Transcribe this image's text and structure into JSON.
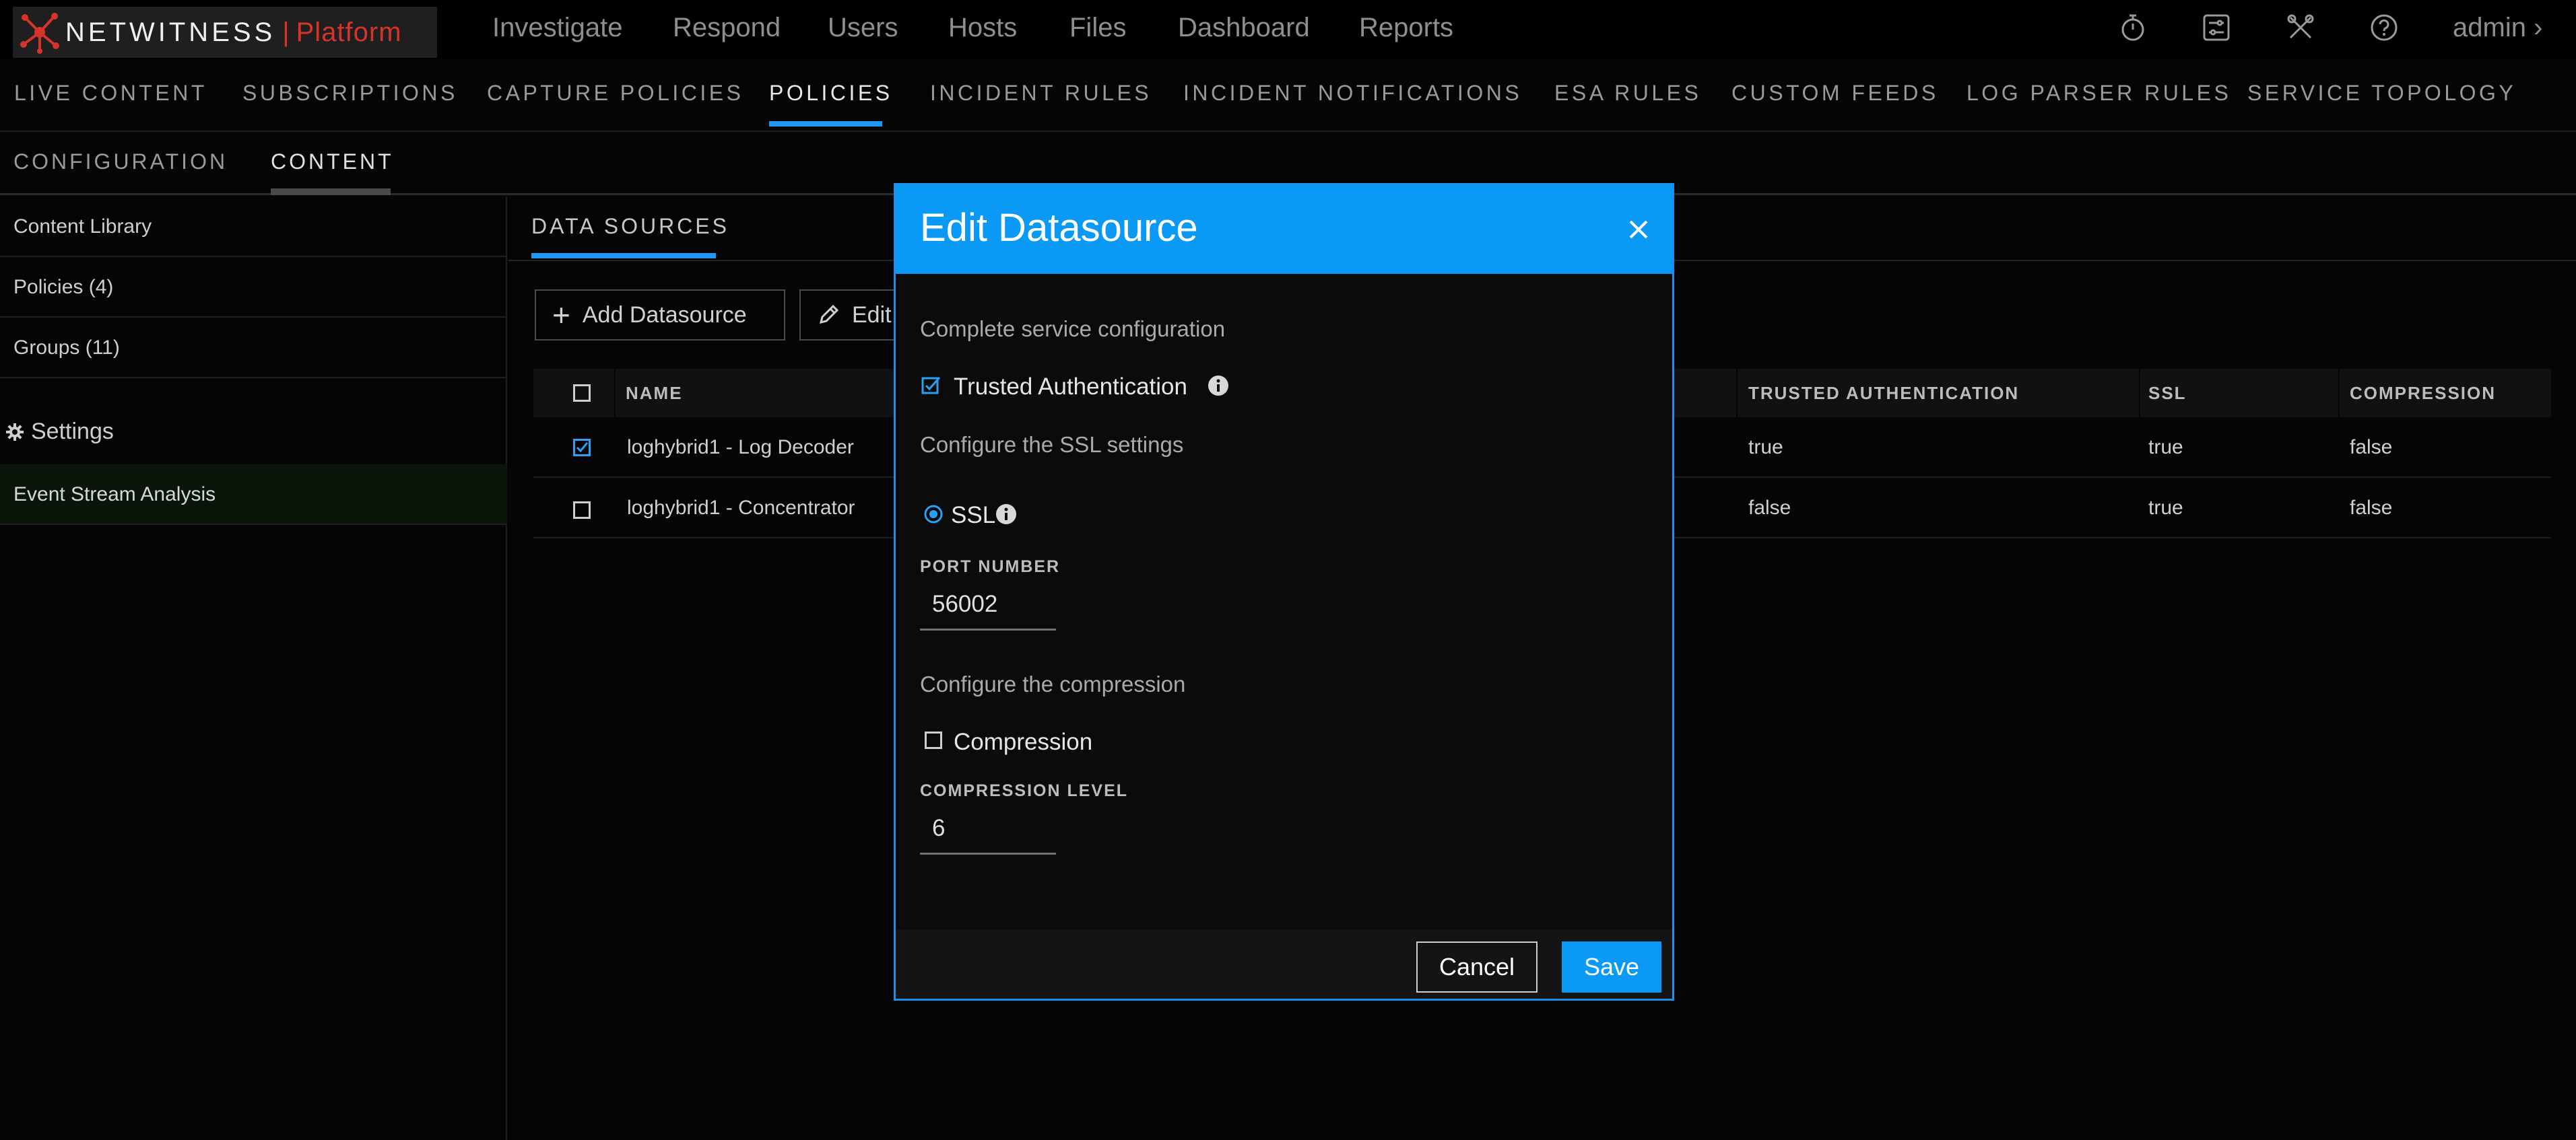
{
  "brand": {
    "name": "NETWITNESS",
    "separator": "|",
    "product": "Platform",
    "colors": {
      "accent": "#0a9af5",
      "brand_red": "#d6342b"
    }
  },
  "topnav": {
    "items": [
      "Investigate",
      "Respond",
      "Users",
      "Hosts",
      "Files",
      "Dashboard",
      "Reports"
    ],
    "icons": [
      "stopwatch-icon",
      "sliders-icon",
      "tools-icon",
      "help-icon"
    ],
    "user": "admin"
  },
  "subnav": {
    "items": [
      "LIVE CONTENT",
      "SUBSCRIPTIONS",
      "CAPTURE POLICIES",
      "POLICIES",
      "INCIDENT RULES",
      "INCIDENT NOTIFICATIONS",
      "ESA RULES",
      "CUSTOM FEEDS",
      "LOG PARSER RULES",
      "SERVICE TOPOLOGY"
    ],
    "active": "POLICIES"
  },
  "thirdnav": {
    "items": [
      "CONFIGURATION",
      "CONTENT"
    ],
    "active": "CONTENT"
  },
  "sidebar": {
    "items": [
      "Content Library",
      "Policies (4)",
      "Groups (11)"
    ],
    "settings_label": "Settings",
    "settings_item": "Event Stream Analysis"
  },
  "main": {
    "tab": "DATA SOURCES",
    "add_button": "Add Datasource",
    "edit_button": "Edit",
    "table": {
      "columns": [
        "NAME",
        "TRUSTED AUTHENTICATION",
        "SSL",
        "COMPRESSION"
      ],
      "rows": [
        {
          "checked": true,
          "name": "loghybrid1 - Log Decoder",
          "trusted": "true",
          "ssl": "true",
          "compression": "false"
        },
        {
          "checked": false,
          "name": "loghybrid1 - Concentrator",
          "trusted": "false",
          "ssl": "true",
          "compression": "false"
        }
      ]
    }
  },
  "modal": {
    "title": "Edit Datasource",
    "service_section": "Complete service configuration",
    "trusted_auth_label": "Trusted Authentication",
    "trusted_auth_checked": true,
    "ssl_section": "Configure the SSL settings",
    "ssl_label": "SSL",
    "ssl_selected": true,
    "port_caption": "PORT NUMBER",
    "port_value": "56002",
    "compression_section": "Configure the compression",
    "compression_label": "Compression",
    "compression_checked": false,
    "compression_level_caption": "COMPRESSION LEVEL",
    "compression_level_value": "6",
    "cancel": "Cancel",
    "save": "Save"
  }
}
